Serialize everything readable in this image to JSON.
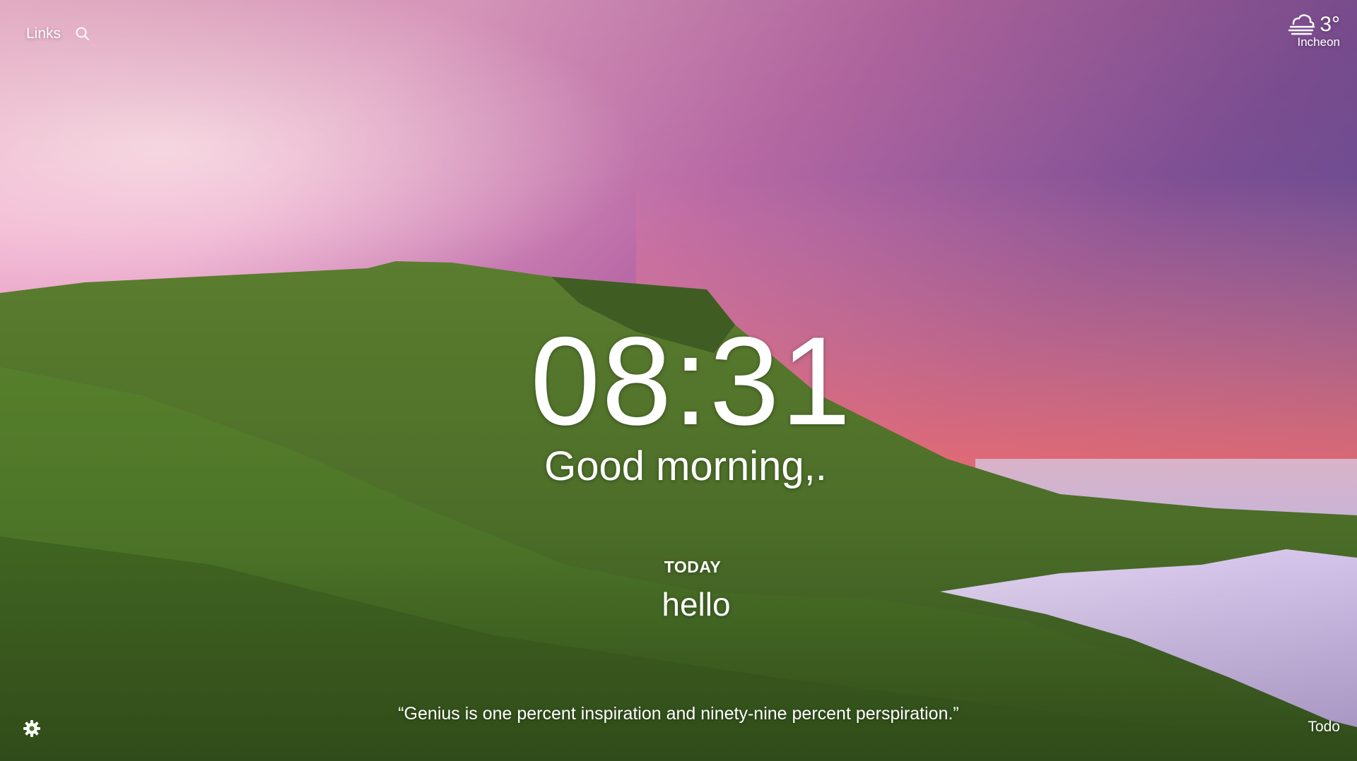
{
  "top_left": {
    "links_label": "Links",
    "search_icon": "search-icon"
  },
  "weather": {
    "icon": "fog-cloud-icon",
    "temperature": "3°",
    "location": "Incheon"
  },
  "main": {
    "time": "08:31",
    "greeting": "Good morning,.",
    "focus_label": "TODAY",
    "focus_text": "hello"
  },
  "quote": {
    "text": "“Genius is one percent inspiration and ninety-nine percent perspiration.”"
  },
  "bottom": {
    "settings_icon": "gear-icon",
    "todo_label": "Todo"
  },
  "colors": {
    "text": "#ffffff",
    "sky_top": "#6a4f93",
    "sky_pink": "#e79ab9",
    "grass": "#4f7a2b",
    "water": "#d8c6ef"
  }
}
